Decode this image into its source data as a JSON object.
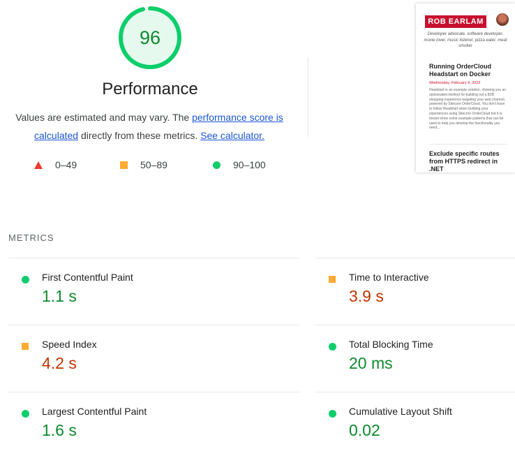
{
  "score": {
    "value": "96",
    "fraction": 0.96,
    "color": "#0cce6b",
    "text_color": "#0c8a2c"
  },
  "category": {
    "title": "Performance",
    "description_prefix": "Values are estimated and may vary. The ",
    "score_link": "performance score is calculated",
    "description_middle": " directly from these metrics. ",
    "calculator_link": "See calculator."
  },
  "legend": {
    "fail": {
      "range": "0–49",
      "icon": "red-triangle-icon",
      "color": "#eb3a2e"
    },
    "average": {
      "range": "50–89",
      "icon": "orange-square-icon",
      "color": "#ffaa33"
    },
    "pass": {
      "range": "90–100",
      "icon": "green-circle-icon",
      "color": "#0cce6b"
    }
  },
  "screenshot": {
    "logo_text": "ROB EARLAM",
    "tagline": "Developer advocate, software developer, movie lover, music listener, pizza eater, meat smoker",
    "post1": {
      "title": "Running OrderCloud Headstart on Docker",
      "date": "Wednesday, February 9, 2022",
      "excerpt": "Headstart is an example solution, showing you an opinionated method for building out a B2B shopping experience targeting your web channel, powered by Sitecore OrderCloud. You don't have to follow Headstart when building your experiences using Sitecore OrderCloud but it is meant show some example patterns that can be used to help you develop the functionality you need...."
    },
    "post2": {
      "title": "Exclude specific routes from HTTPS redirect in .NET"
    }
  },
  "metrics": {
    "header": "METRICS",
    "items": [
      {
        "name": "First Contentful Paint",
        "value": "1.1 s",
        "rating": "pass"
      },
      {
        "name": "Time to Interactive",
        "value": "3.9 s",
        "rating": "average"
      },
      {
        "name": "Speed Index",
        "value": "4.2 s",
        "rating": "average"
      },
      {
        "name": "Total Blocking Time",
        "value": "20 ms",
        "rating": "pass"
      },
      {
        "name": "Largest Contentful Paint",
        "value": "1.6 s",
        "rating": "pass"
      },
      {
        "name": "Cumulative Layout Shift",
        "value": "0.02",
        "rating": "pass"
      }
    ]
  }
}
